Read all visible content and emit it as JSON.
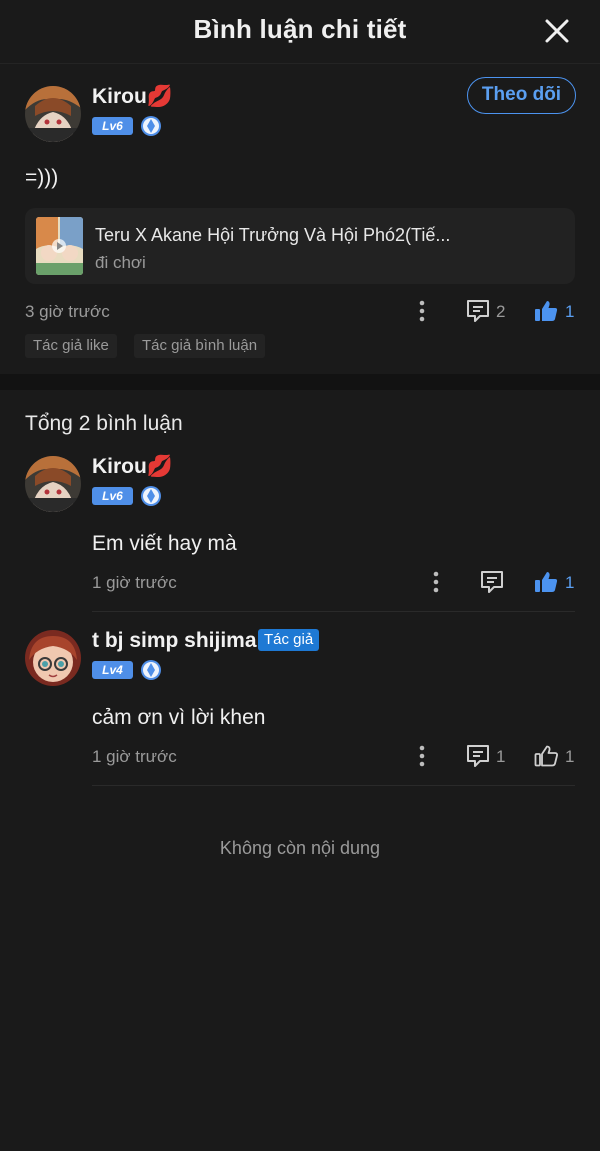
{
  "header": {
    "title": "Bình luận chi tiết"
  },
  "main_comment": {
    "username": "Kirou💋",
    "level": "Lv6",
    "follow_label": "Theo dõi",
    "text": "=)))",
    "story": {
      "title": "Teru X Akane Hội Trưởng Và Hội Phó2(Tiế...",
      "subtitle": "đi chơi"
    },
    "time": "3 giờ trước",
    "comment_count": "2",
    "like_count": "1",
    "tags": [
      "Tác giả like",
      "Tác giả bình luận"
    ]
  },
  "total_label": "Tổng 2 bình luận",
  "replies": [
    {
      "username": "Kirou💋",
      "level": "Lv6",
      "text": "Em viết hay mà",
      "time": "1 giờ trước",
      "comment_count": "",
      "like_count": "1"
    },
    {
      "username": "t bj simp shijima",
      "badge": "Tác giả",
      "level": "Lv4",
      "text": "cảm ơn vì lời khen",
      "time": "1 giờ trước",
      "comment_count": "1",
      "like_count": "1"
    }
  ],
  "end_text": "Không còn nội dung",
  "colors": {
    "accent": "#4c93ef",
    "background": "#1a1a1a",
    "author_badge": "#1e79d4",
    "level_badge": "#4f8fe8"
  }
}
